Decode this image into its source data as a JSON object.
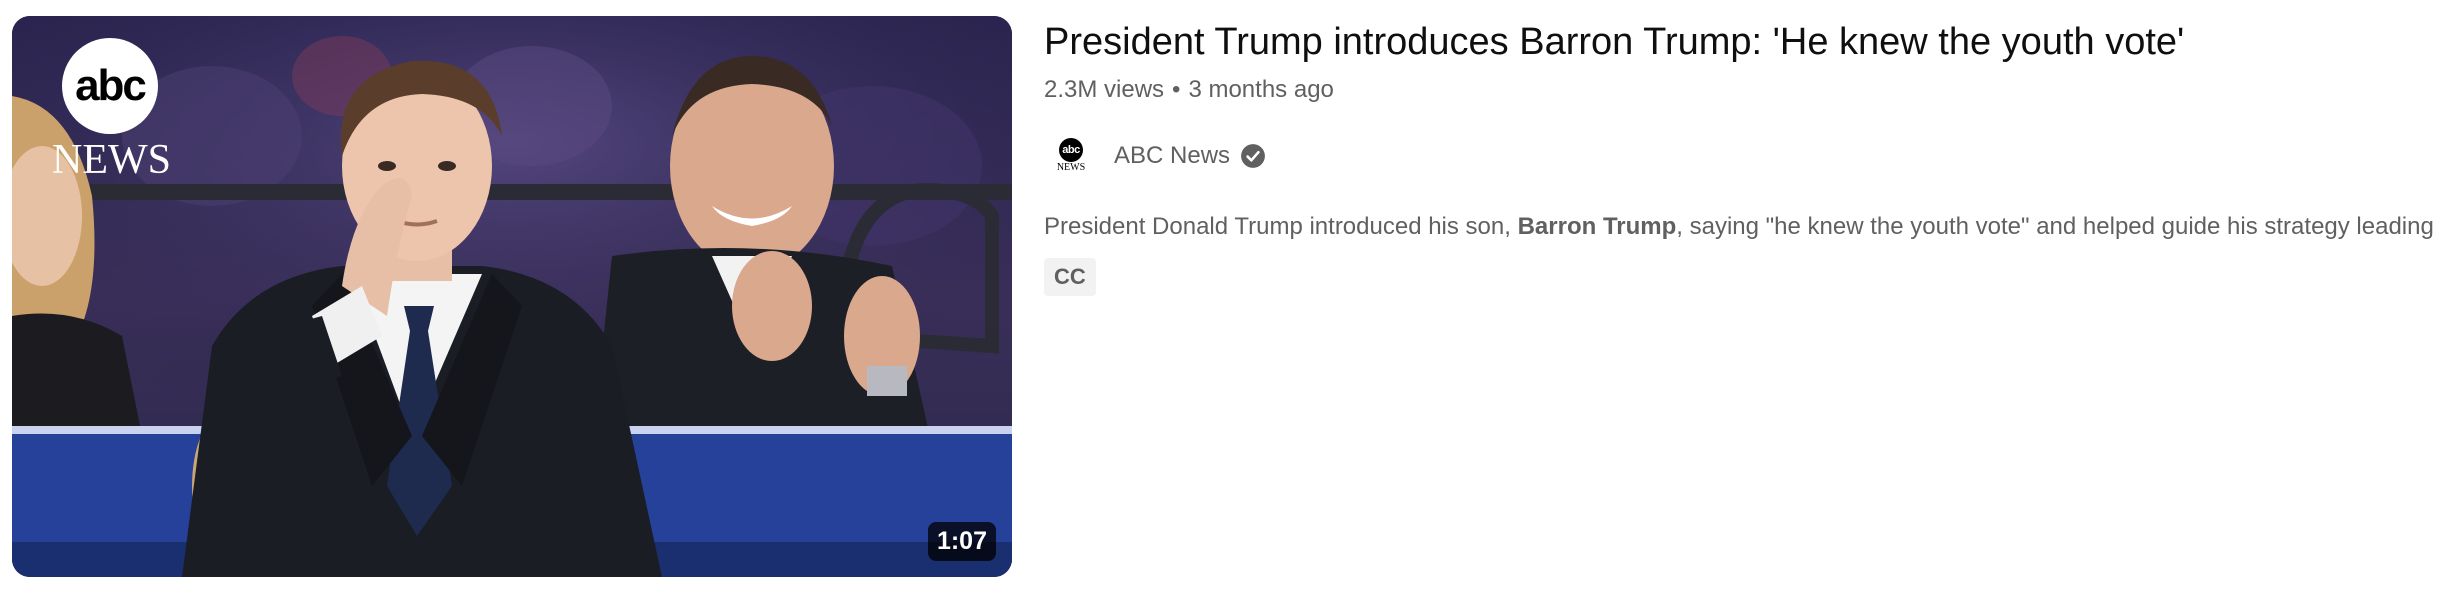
{
  "video": {
    "title": "President Trump introduces Barron Trump: 'He knew the youth vote'",
    "views": "2.3M views",
    "separator": "•",
    "age": "3 months ago",
    "duration": "1:07",
    "thumbnail": {
      "logo_text": "abc",
      "logo_subtext": "NEWS"
    },
    "channel": {
      "name": "ABC News",
      "avatar_text": "abc",
      "avatar_subtext": "NEWS",
      "verified_icon": "verified-check-icon"
    },
    "description": {
      "prefix": "President Donald Trump introduced his son, ",
      "bold": "Barron Trump",
      "suffix": ", saying \"he knew the youth vote\" and helped guide his strategy leading ..."
    },
    "badges": [
      "CC"
    ]
  },
  "colors": {
    "title": "#0f0f0f",
    "secondary_text": "#606060",
    "badge_bg": "#f2f2f2",
    "duration_bg": "#000000"
  }
}
